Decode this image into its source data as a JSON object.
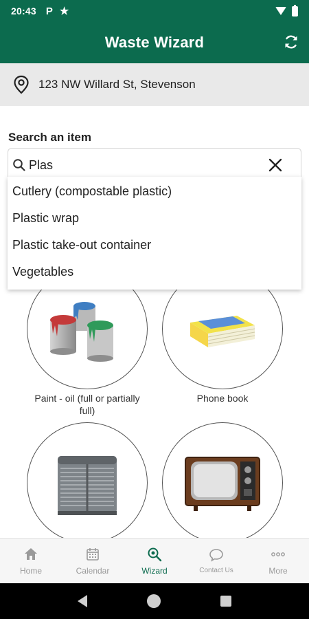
{
  "status_bar": {
    "time": "20:43",
    "icons": [
      "parking-icon",
      "star-icon",
      "wifi-icon",
      "battery-icon"
    ],
    "p_glyph": "P",
    "star_glyph": "★"
  },
  "app_bar": {
    "title": "Waste Wizard",
    "refresh_icon": "refresh-icon"
  },
  "address": {
    "text": "123 NW Willard St, Stevenson",
    "icon": "location-pin-icon"
  },
  "search": {
    "label": "Search an item",
    "value": "Plas",
    "clear_icon": "close-icon",
    "suggestions": [
      "Cutlery (compostable plastic)",
      "Plastic wrap",
      "Plastic take-out container",
      "Vegetables"
    ]
  },
  "items": [
    {
      "label": "Paint - oil (full or partially full)",
      "image": "paint-cans-image"
    },
    {
      "label": "Phone book",
      "image": "phone-book-image"
    },
    {
      "label": "",
      "image": "air-conditioner-image"
    },
    {
      "label": "",
      "image": "television-image"
    }
  ],
  "bottom_nav": [
    {
      "label": "Home",
      "icon": "home-icon",
      "active": false
    },
    {
      "label": "Calendar",
      "icon": "calendar-icon",
      "active": false
    },
    {
      "label": "Wizard",
      "icon": "wizard-search-icon",
      "active": true
    },
    {
      "label": "Contact Us",
      "icon": "chat-icon",
      "active": false
    },
    {
      "label": "More",
      "icon": "more-icon",
      "active": false
    }
  ],
  "colors": {
    "brand": "#0c6b4e",
    "address_bg": "#e9e9e9",
    "nav_bg": "#f6f6f6",
    "inactive": "#9a9a9a"
  }
}
